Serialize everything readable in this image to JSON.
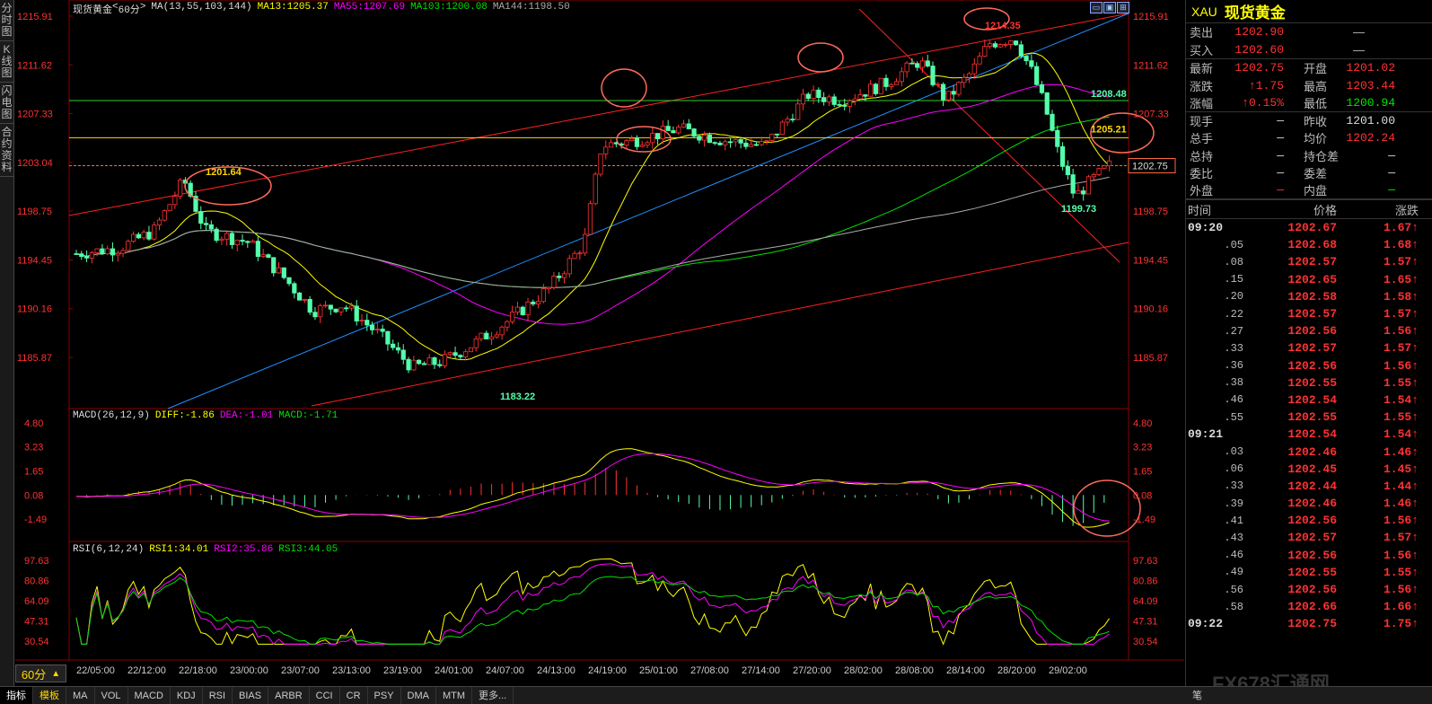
{
  "left_tabs": [
    {
      "label": "分时图"
    },
    {
      "label": "K线图"
    },
    {
      "label": "闪电图"
    },
    {
      "label": "合约资料"
    }
  ],
  "chart": {
    "name": "现货黄金",
    "period": "60分",
    "ma_label": "MA(13,55,103,144)",
    "ma13": "MA13:1205.37",
    "ma55": "MA55:1207.69",
    "ma103": "MA103:1200.08",
    "ma144": "MA144:1198.50",
    "colors": {
      "ma13": "#ffff00",
      "ma55": "#ff00ff",
      "ma103": "#00e000",
      "ma144": "#aaaaaa",
      "up": "#ff3232",
      "down": "#54ffac"
    },
    "price_ticks": [
      "1215.91",
      "1211.62",
      "1207.33",
      "1203.04",
      "1198.75",
      "1194.45",
      "1190.16",
      "1185.87"
    ],
    "current_price": "1202.75",
    "annotations": {
      "high": "1214.35",
      "low": "1183.22",
      "p1201": "1201.64",
      "p1208": "1208.48",
      "p1205": "1205.21",
      "p1199": "1199.73"
    },
    "x_labels": [
      "22/05:00",
      "22/12:00",
      "22/18:00",
      "23/00:00",
      "23/07:00",
      "23/13:00",
      "23/19:00",
      "24/01:00",
      "24/07:00",
      "24/13:00",
      "24/19:00",
      "25/01:00",
      "27/08:00",
      "27/14:00",
      "27/20:00",
      "28/02:00",
      "28/08:00",
      "28/14:00",
      "28/20:00",
      "29/02:00"
    ],
    "macd": {
      "title": "MACD(26,12,9)",
      "diff": "DIFF:-1.86",
      "dea": "DEA:-1.01",
      "macd": "MACD:-1.71",
      "ticks": [
        "4.80",
        "3.23",
        "1.65",
        "0.08",
        "-1.49"
      ]
    },
    "rsi": {
      "title": "RSI(6,12,24)",
      "rsi1": "RSI1:34.01",
      "rsi2": "RSI2:35.86",
      "rsi3": "RSI3:44.05",
      "ticks": [
        "97.63",
        "80.86",
        "64.09",
        "47.31",
        "30.54"
      ]
    }
  },
  "quote": {
    "symbol": "XAU",
    "name": "现货黄金",
    "rows": [
      {
        "l1": "卖出",
        "v1": "1202.90",
        "d1": "—",
        "c1": "red"
      },
      {
        "l1": "买入",
        "v1": "1202.60",
        "d1": "—",
        "c1": "red"
      }
    ],
    "stats": [
      {
        "l1": "最新",
        "v1": "1202.75",
        "c1": "red",
        "l2": "开盘",
        "v2": "1201.02",
        "c2": "red"
      },
      {
        "l1": "涨跌",
        "v1": "↑1.75",
        "c1": "red",
        "l2": "最高",
        "v2": "1203.44",
        "c2": "red"
      },
      {
        "l1": "涨幅",
        "v1": "↑0.15%",
        "c1": "red",
        "l2": "最低",
        "v2": "1200.94",
        "c2": "green"
      },
      {
        "l1": "现手",
        "v1": "—",
        "c1": "white",
        "l2": "昨收",
        "v2": "1201.00",
        "c2": "white"
      },
      {
        "l1": "总手",
        "v1": "—",
        "c1": "white",
        "l2": "均价",
        "v2": "1202.24",
        "c2": "red"
      },
      {
        "l1": "总持",
        "v1": "—",
        "c1": "white",
        "l2": "持仓差",
        "v2": "—",
        "c2": "white"
      },
      {
        "l1": "委比",
        "v1": "—",
        "c1": "white",
        "l2": "委差",
        "v2": "—",
        "c2": "white"
      },
      {
        "l1": "外盘",
        "v1": "—",
        "c1": "red",
        "l2": "内盘",
        "v2": "—",
        "c2": "green"
      }
    ],
    "ticks_header": {
      "time": "时间",
      "price": "价格",
      "chg": "涨跌"
    },
    "ticks": [
      {
        "t": "09:20",
        "p": "1202.67",
        "c": "1.67↑",
        "big": true
      },
      {
        "t": ".05",
        "p": "1202.68",
        "c": "1.68↑"
      },
      {
        "t": ".08",
        "p": "1202.57",
        "c": "1.57↑"
      },
      {
        "t": ".15",
        "p": "1202.65",
        "c": "1.65↑"
      },
      {
        "t": ".20",
        "p": "1202.58",
        "c": "1.58↑"
      },
      {
        "t": ".22",
        "p": "1202.57",
        "c": "1.57↑"
      },
      {
        "t": ".27",
        "p": "1202.56",
        "c": "1.56↑"
      },
      {
        "t": ".33",
        "p": "1202.57",
        "c": "1.57↑"
      },
      {
        "t": ".36",
        "p": "1202.56",
        "c": "1.56↑"
      },
      {
        "t": ".38",
        "p": "1202.55",
        "c": "1.55↑"
      },
      {
        "t": ".46",
        "p": "1202.54",
        "c": "1.54↑"
      },
      {
        "t": ".55",
        "p": "1202.55",
        "c": "1.55↑"
      },
      {
        "t": "09:21",
        "p": "1202.54",
        "c": "1.54↑",
        "big": true
      },
      {
        "t": ".03",
        "p": "1202.46",
        "c": "1.46↑"
      },
      {
        "t": ".06",
        "p": "1202.45",
        "c": "1.45↑"
      },
      {
        "t": ".33",
        "p": "1202.44",
        "c": "1.44↑"
      },
      {
        "t": ".39",
        "p": "1202.46",
        "c": "1.46↑"
      },
      {
        "t": ".41",
        "p": "1202.56",
        "c": "1.56↑"
      },
      {
        "t": ".43",
        "p": "1202.57",
        "c": "1.57↑"
      },
      {
        "t": ".46",
        "p": "1202.56",
        "c": "1.56↑"
      },
      {
        "t": ".49",
        "p": "1202.55",
        "c": "1.55↑"
      },
      {
        "t": ".56",
        "p": "1202.56",
        "c": "1.56↑"
      },
      {
        "t": ".58",
        "p": "1202.66",
        "c": "1.66↑"
      },
      {
        "t": "09:22",
        "p": "1202.75",
        "c": "1.75↑",
        "big": true
      }
    ]
  },
  "bottom_tabs": [
    "指标",
    "模板",
    "MA",
    "VOL",
    "MACD",
    "KDJ",
    "RSI",
    "BIAS",
    "ARBR",
    "CCI",
    "CR",
    "PSY",
    "DMA",
    "MTM",
    "更多..."
  ],
  "bottom_right": "笔",
  "watermark": "FX678汇通网"
}
